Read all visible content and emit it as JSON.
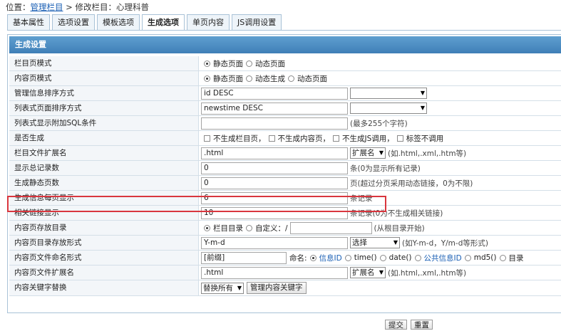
{
  "breadcrumb": {
    "prefix": "位置：",
    "link": "管理栏目",
    "rest": " > 修改栏目：心理科普"
  },
  "tabs": [
    "基本属性",
    "选项设置",
    "模板选项",
    "生成选项",
    "单页内容",
    "JS调用设置"
  ],
  "section_title": "生成设置",
  "rows": {
    "list_mode": {
      "label": "栏目页模式",
      "opt1": "静态页面",
      "opt2": "动态页面"
    },
    "content_mode": {
      "label": "内容页模式",
      "opt1": "静态页面",
      "opt2": "动态生成",
      "opt3": "动态页面"
    },
    "manage_sort": {
      "label": "管理信息排序方式",
      "value": "id DESC"
    },
    "list_sort": {
      "label": "列表式页面排序方式",
      "value": "newstime DESC"
    },
    "list_sql": {
      "label": "列表式显示附加SQL条件",
      "value": "",
      "hint": "(最多255个字符)"
    },
    "gen": {
      "label": "是否生成",
      "c1": "不生成栏目页，",
      "c2": "不生成内容页，",
      "c3": "不生成JS调用，",
      "c4": "标签不调用"
    },
    "list_ext": {
      "label": "栏目文件扩展名",
      "value": ".html",
      "btn": "扩展名",
      "hint": "(如.html,.xml,.htm等)"
    },
    "total": {
      "label": "显示总记录数",
      "value": "0",
      "hint": "条(0为显示所有记录)"
    },
    "static_pages": {
      "label": "生成静态页数",
      "value": "0",
      "hint": "页(超过分页采用动态链接，0为不限)"
    },
    "per_page": {
      "label": "生成信息每页显示",
      "value": "6",
      "hint": "条记录"
    },
    "related": {
      "label": "相关链接显示",
      "value": "10",
      "hint": "条记录(0为不生成相关链接)"
    },
    "content_dir": {
      "label": "内容页存放目录",
      "opt1": "栏目目录",
      "opt2": "自定义：/",
      "hint": "(从根目录开始)"
    },
    "content_dir_fmt": {
      "label": "内容页目录存放形式",
      "value": "Y-m-d",
      "select": "选择",
      "hint": "(如Y-m-d，Y/m-d等形式)"
    },
    "content_name": {
      "label": "内容页文件命名形式",
      "prefix_val": "[前缀]",
      "naming": "命名:",
      "o1": "信息ID",
      "o2": "time()",
      "o3": "date()",
      "o4": "公共信息ID",
      "o5": "md5()",
      "o6": "目录"
    },
    "content_ext": {
      "label": "内容页文件扩展名",
      "value": ".html",
      "btn": "扩展名",
      "hint": "(如.html,.xml,.htm等)"
    },
    "keyword": {
      "label": "内容关键字替换",
      "select": "替换所有",
      "btn": "管理内容关键字"
    }
  },
  "bottom": {
    "submit": "提交",
    "reset": "重置"
  }
}
